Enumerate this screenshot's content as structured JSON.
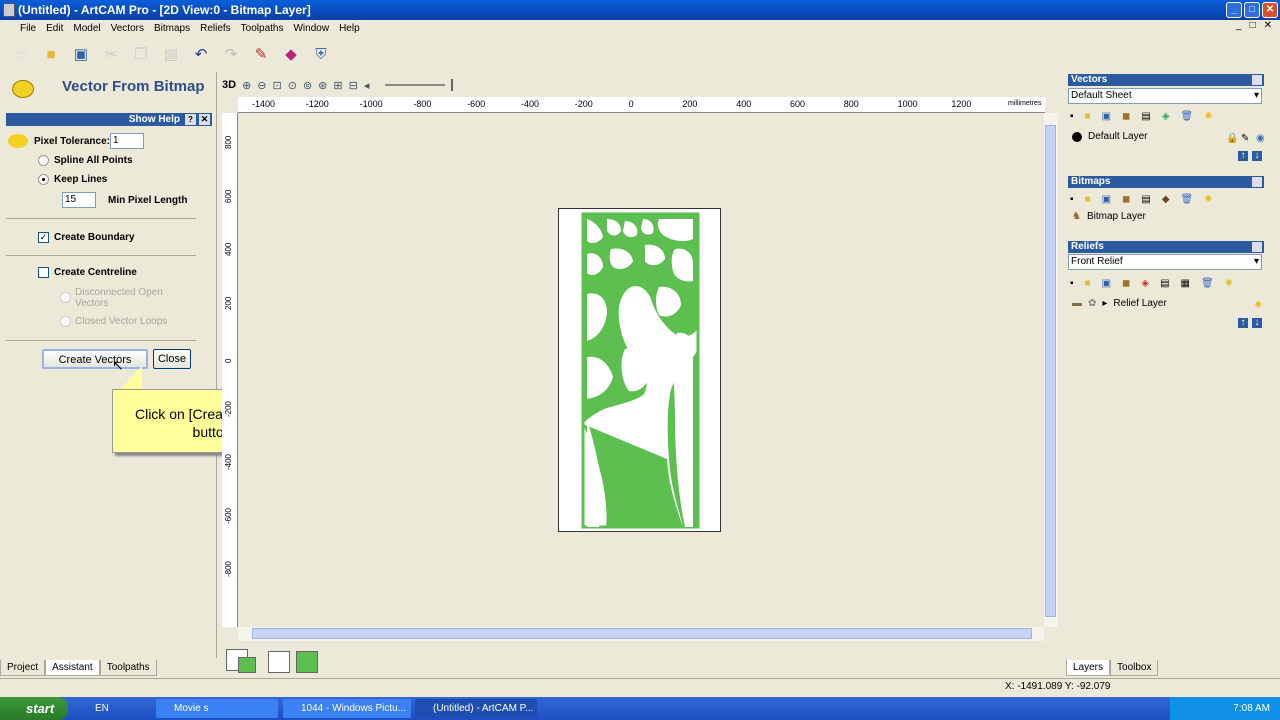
{
  "window": {
    "title": "(Untitled) - ArtCAM Pro - [2D View:0 - Bitmap Layer]",
    "min": "_",
    "max": "□",
    "close": "✕"
  },
  "menu": [
    "File",
    "Edit",
    "Model",
    "Vectors",
    "Bitmaps",
    "Reliefs",
    "Toolpaths",
    "Window",
    "Help"
  ],
  "mdi_controls": [
    "_",
    "□",
    "✕"
  ],
  "toolbar_icons": [
    "new-icon",
    "open-icon",
    "save-icon",
    "cut-icon",
    "copy-icon",
    "paste-icon",
    "undo-icon",
    "redo-icon",
    "wizard-icon",
    "book-icon",
    "shield-icon"
  ],
  "assistant": {
    "title": "Vector From Bitmap",
    "show_help": "Show Help",
    "help_btn": "?",
    "close_btn": "✕",
    "pixel_tolerance_label": "Pixel Tolerance:",
    "pixel_tolerance_value": "1",
    "spline_all": "Spline All Points",
    "keep_lines": "Keep Lines",
    "min_pixel_value": "15",
    "min_pixel_label": "Min Pixel Length",
    "create_boundary": "Create Boundary",
    "create_centreline": "Create Centreline",
    "disconnected": "Disconnected Open Vectors",
    "closed_loops": "Closed Vector Loops",
    "create_vectors_btn": "Create Vectors",
    "close_btn_label": "Close"
  },
  "tooltip": {
    "line1": "Click on [Create Vectors]",
    "line2": "button"
  },
  "left_tabs": [
    "Project",
    "Assistant",
    "Toolpaths"
  ],
  "view_toolbar": {
    "label_3d": "3D"
  },
  "hruler": {
    "labels": [
      "-1400",
      "-1200",
      "-1000",
      "-800",
      "-600",
      "-400",
      "-200",
      "0",
      "200",
      "400",
      "600",
      "800",
      "1000",
      "1200"
    ],
    "unit": "millimetres"
  },
  "vruler": {
    "labels": [
      "800",
      "600",
      "400",
      "200",
      "0",
      "-200",
      "-400",
      "-600",
      "-800"
    ]
  },
  "colors": {
    "green": "#5cbf50",
    "white": "#ffffff"
  },
  "right_panel": {
    "vectors_header": "Vectors",
    "vectors_sheet": "Default Sheet",
    "default_layer": "Default Layer",
    "bitmaps_header": "Bitmaps",
    "bitmap_layer": "Bitmap Layer",
    "reliefs_header": "Reliefs",
    "reliefs_combo": "Front Relief",
    "relief_layer": "Relief Layer"
  },
  "right_tabs": [
    "Layers",
    "Toolbox"
  ],
  "status": {
    "coords": "X: -1491.089  Y: -92.079"
  },
  "taskbar": {
    "start": "start",
    "lang": "EN",
    "tasks": [
      "Movie s",
      "1044 - Windows Pictu...",
      "(Untitled) - ArtCAM P..."
    ],
    "time": "7:08 AM"
  }
}
